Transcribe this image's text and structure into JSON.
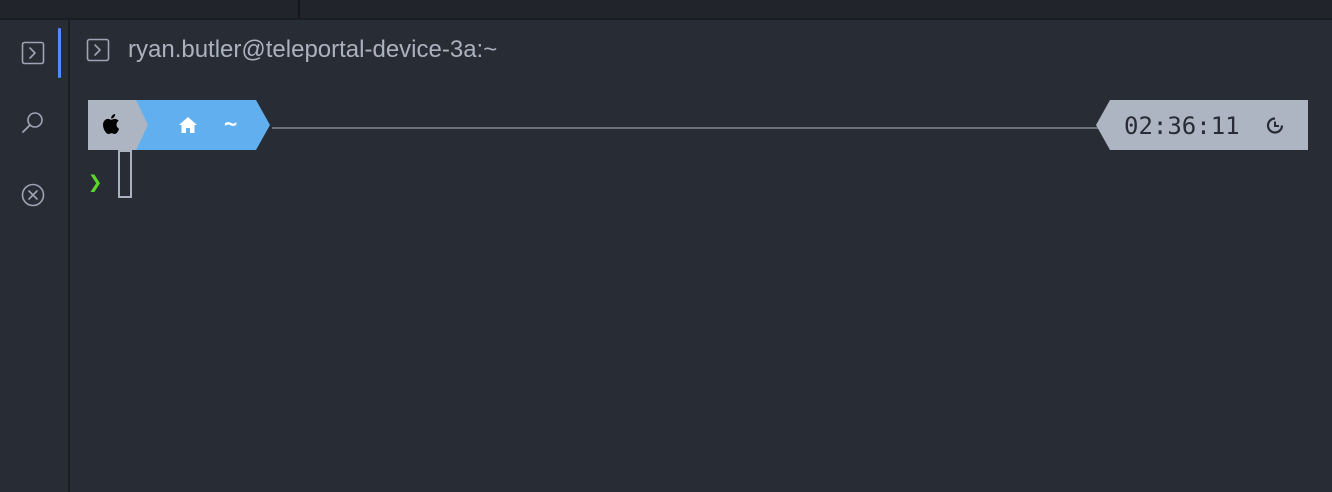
{
  "window": {
    "title": "ryan.butler@teleportal-device-3a:~"
  },
  "sidebar": {
    "items": [
      {
        "name": "terminal",
        "icon": "terminal-icon",
        "active": true
      },
      {
        "name": "search",
        "icon": "search-icon",
        "active": false
      },
      {
        "name": "close",
        "icon": "close-circle-icon",
        "active": false
      }
    ]
  },
  "prompt": {
    "os_icon": "apple-icon",
    "dir_icon": "home-icon",
    "dir": "~",
    "time": "02:36:11",
    "time_icon": "clock-icon",
    "prompt_char": "❯"
  },
  "colors": {
    "background": "#282c34",
    "accent": "#528bff",
    "dir_segment": "#61afef",
    "os_segment": "#adb5c2",
    "prompt_char": "#5dd62a",
    "text": "#abb2bf"
  }
}
